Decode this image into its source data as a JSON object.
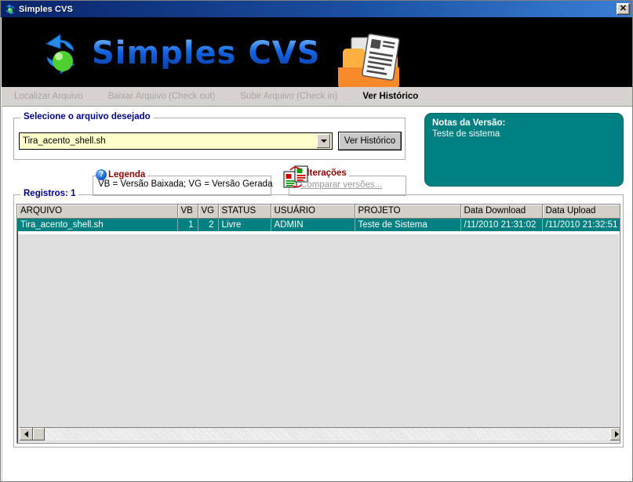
{
  "window": {
    "title": "Simples CVS",
    "icon": "recycle-icon",
    "close_label": "✕"
  },
  "banner": {
    "logo_primary": "S",
    "logo_word1": "IMPLES",
    "logo_word2": "CVS",
    "logo_full": "Simples CVS"
  },
  "menu": {
    "tabs": [
      {
        "label": "Localizar Arquivo",
        "active": false
      },
      {
        "label": "Baixar Arquivo (Check out)",
        "active": false
      },
      {
        "label": "Subir Arquivo (Check in)",
        "active": false
      },
      {
        "label": "Ver Histórico",
        "active": true
      }
    ]
  },
  "select_group": {
    "legend": "Selecione o arquivo desejado",
    "combo_value": "Tira_acento_shell.sh",
    "combo_arrow_icon": "chevron-down-icon",
    "button_label": "Ver Histórico"
  },
  "notes": {
    "title": "Notas da Versão:",
    "text": "Teste de sistema"
  },
  "legenda": {
    "icon": "help-circle-icon",
    "title": "Legenda",
    "text": "VB = Versão Baixada;  VG = Versão Gerada"
  },
  "alteracoes": {
    "icon": "compare-documents-icon",
    "title": "Alterações",
    "link_label": "Comparar versões..."
  },
  "registros": {
    "legend": "Registros: 1",
    "columns": [
      "ARQUIVO",
      "VB",
      "VG",
      "STATUS",
      "USUÁRIO",
      "PROJETO",
      "Data Download",
      "Data Upload"
    ],
    "rows": [
      {
        "arquivo": "Tira_acento_shell.sh",
        "vb": "1",
        "vg": "2",
        "status": "Livre",
        "usuario": "ADMIN",
        "projeto": "Teste de Sistema",
        "data_download": "/11/2010 21:31:02",
        "data_upload": "/11/2010 21:32:51"
      }
    ]
  },
  "scrollbar": {
    "left_icon": "arrow-left-icon",
    "right_icon": "arrow-right-icon"
  },
  "colors": {
    "titlebar": "#0a246a",
    "banner": "#000000",
    "selection": "#008080",
    "notes_bg": "#008080",
    "combo_bg": "#ffffcc",
    "legend_text": "#00008b",
    "group_title_red": "#8b0000"
  }
}
